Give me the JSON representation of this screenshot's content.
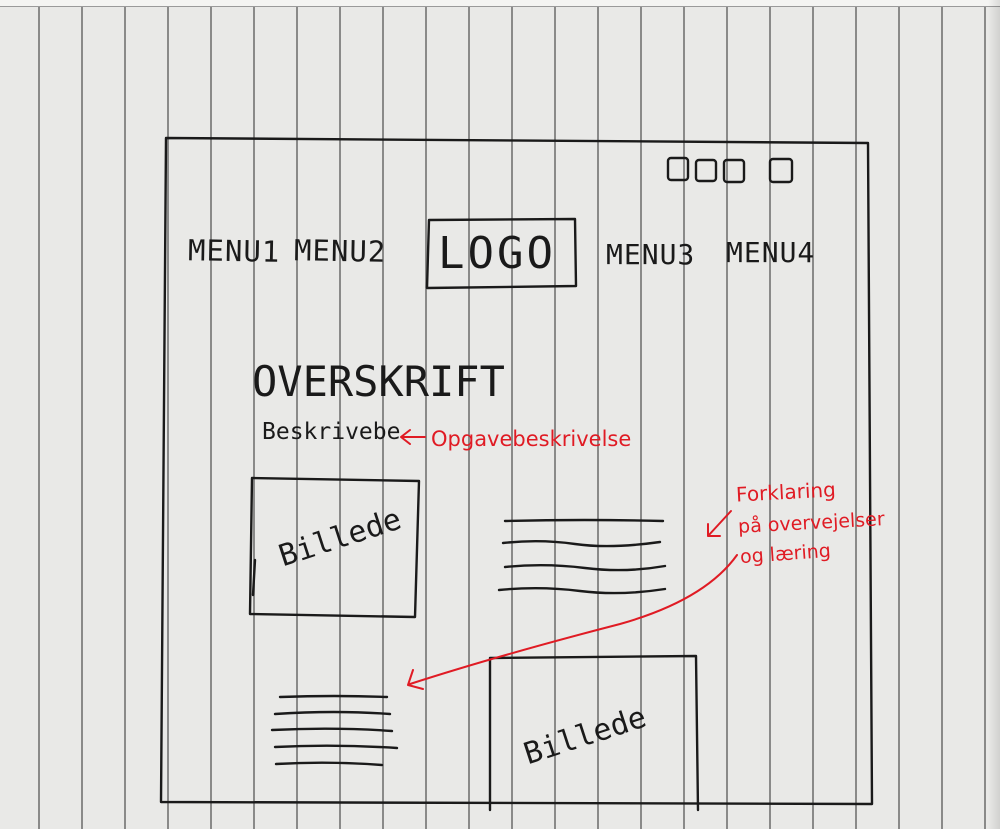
{
  "header": {
    "icons": [
      "square-icon",
      "square-icon",
      "square-icon",
      "square-icon"
    ],
    "menu_items": [
      "MENU1",
      "MENU2",
      "MENU3",
      "MENU4"
    ],
    "logo": "LOGO"
  },
  "content": {
    "heading": "OVERSKRIFT",
    "description": "Beskrivebe",
    "image_label_1": "Billede",
    "image_label_2": "Billede"
  },
  "annotations": {
    "task_note": "Opgavebeskrivelse",
    "explanation_lines": [
      "Forklaring",
      "på overvejelser",
      "og læring"
    ]
  },
  "colors": {
    "ink": "#1a1a1a",
    "annotation": "#e01b24",
    "paper": "#e9e9e7"
  }
}
